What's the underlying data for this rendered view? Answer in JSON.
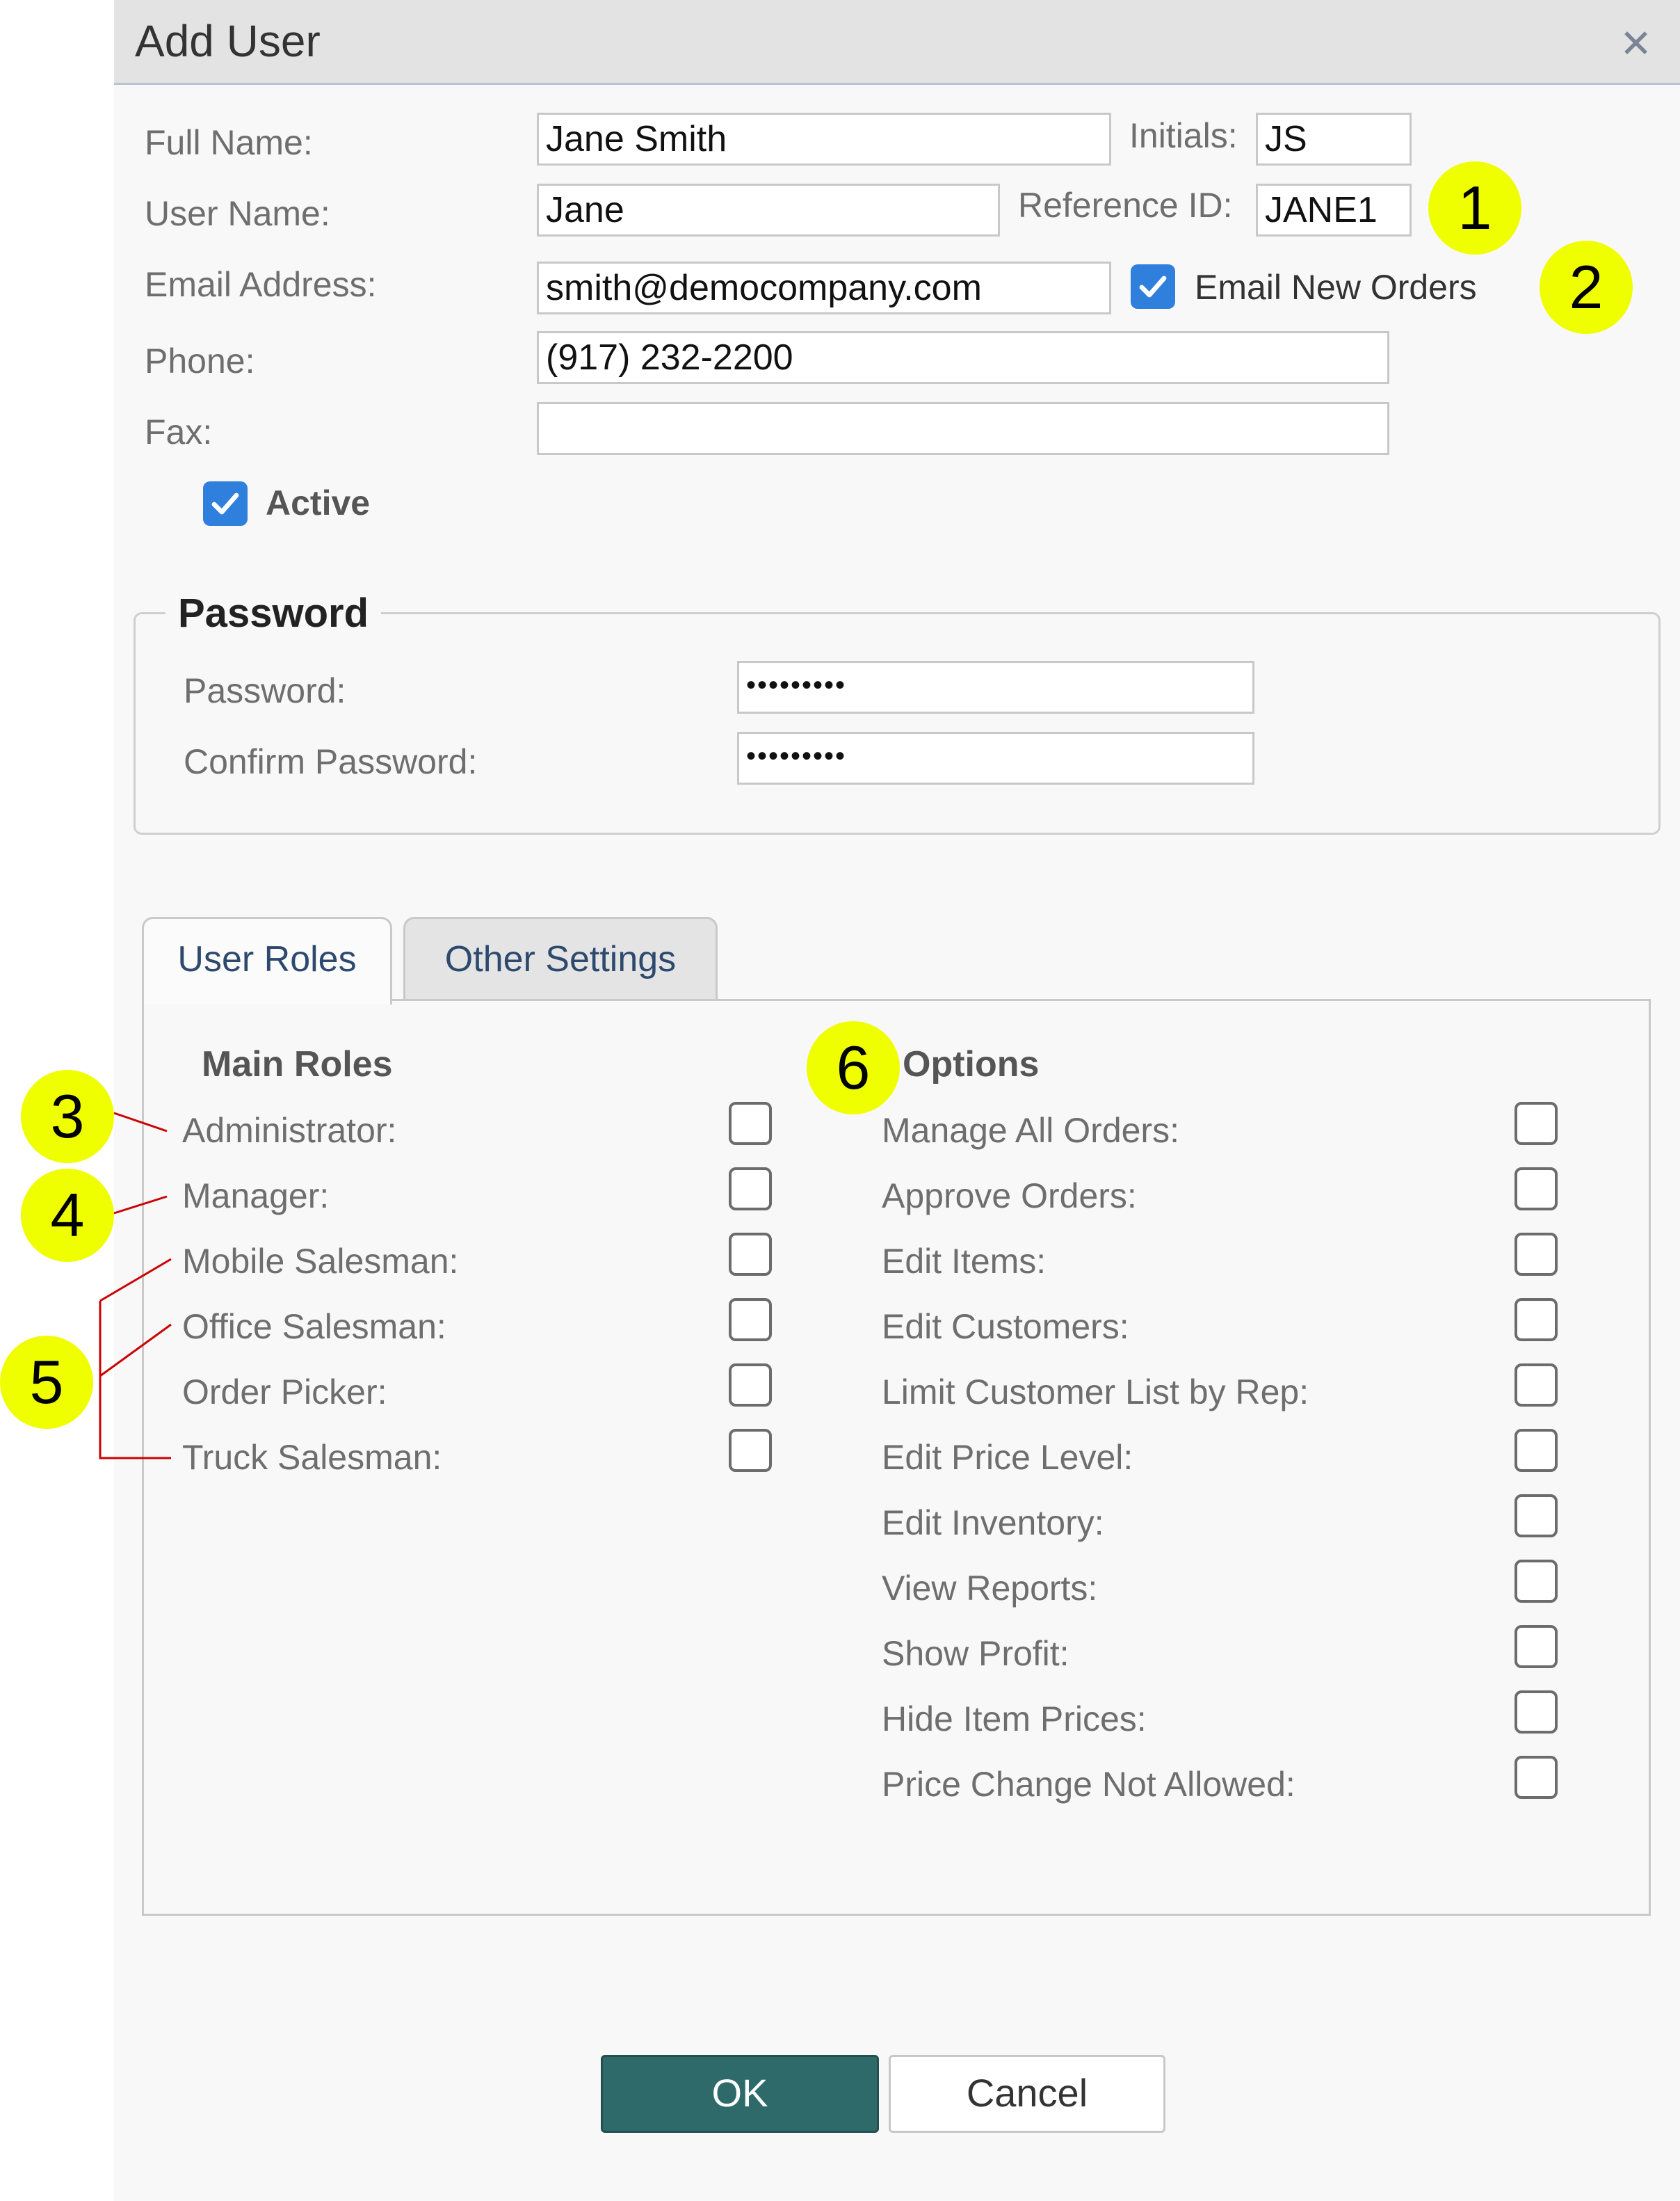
{
  "dialog": {
    "title": "Add User",
    "close_icon": "close-icon"
  },
  "form": {
    "full_name": {
      "label": "Full Name:",
      "value": "Jane Smith"
    },
    "initials": {
      "label": "Initials:",
      "value": "JS"
    },
    "user_name": {
      "label": "User Name:",
      "value": "Jane"
    },
    "reference_id": {
      "label": "Reference ID:",
      "value": "JANE1"
    },
    "email": {
      "label": "Email Address:",
      "value": "smith@democompany.com"
    },
    "email_new_orders": {
      "label": "Email New Orders",
      "checked": true
    },
    "phone": {
      "label": "Phone:",
      "value": "(917) 232-2200"
    },
    "fax": {
      "label": "Fax:",
      "value": ""
    },
    "active": {
      "label": "Active",
      "checked": true
    }
  },
  "password_section": {
    "title": "Password",
    "password": {
      "label": "Password:",
      "value": "•••••••••"
    },
    "confirm": {
      "label": "Confirm Password:",
      "value": "•••••••••"
    }
  },
  "tabs": [
    {
      "label": "User Roles",
      "active": true
    },
    {
      "label": "Other Settings",
      "active": false
    }
  ],
  "main_roles": {
    "title": "Main Roles",
    "items": [
      {
        "label": "Administrator:",
        "checked": false
      },
      {
        "label": "Manager:",
        "checked": false
      },
      {
        "label": "Mobile Salesman:",
        "checked": false
      },
      {
        "label": "Office Salesman:",
        "checked": false
      },
      {
        "label": "Order Picker:",
        "checked": false
      },
      {
        "label": "Truck Salesman:",
        "checked": false
      }
    ]
  },
  "options": {
    "title": "Options",
    "items": [
      {
        "label": "Manage All Orders:",
        "checked": false
      },
      {
        "label": "Approve Orders:",
        "checked": false
      },
      {
        "label": "Edit Items:",
        "checked": false
      },
      {
        "label": "Edit Customers:",
        "checked": false
      },
      {
        "label": "Limit Customer List by Rep:",
        "checked": false
      },
      {
        "label": "Edit Price Level:",
        "checked": false
      },
      {
        "label": "Edit Inventory:",
        "checked": false
      },
      {
        "label": "View Reports:",
        "checked": false
      },
      {
        "label": "Show Profit:",
        "checked": false
      },
      {
        "label": "Hide Item Prices:",
        "checked": false
      },
      {
        "label": "Price Change Not Allowed:",
        "checked": false
      }
    ]
  },
  "buttons": {
    "ok": "OK",
    "cancel": "Cancel"
  },
  "callouts": [
    "1",
    "2",
    "3",
    "4",
    "5",
    "6"
  ],
  "colors": {
    "callout": "#f0ff00",
    "callout_line": "#cc0000",
    "ok_button": "#2e6a6a",
    "checkbox_checked": "#2f7fdd"
  }
}
